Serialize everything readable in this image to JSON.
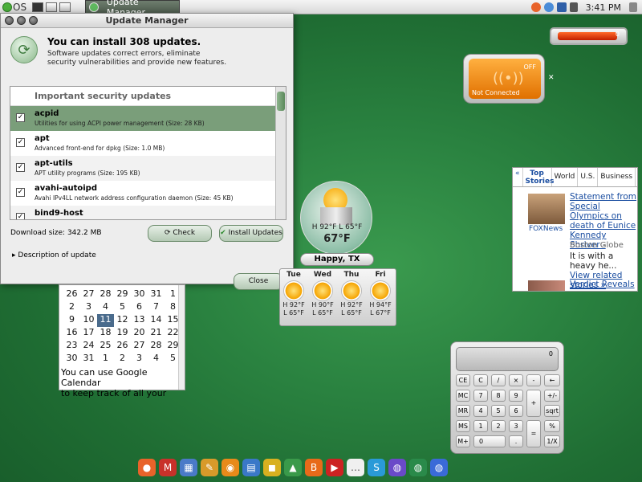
{
  "top_panel": {
    "os_label": "OS",
    "task_button": "Update Manager",
    "clock": "3:41 PM"
  },
  "update_window": {
    "title": "Update Manager",
    "heading": "You can install 308 updates.",
    "subtext_line1": "Software updates correct errors, eliminate",
    "subtext_line2": "security vulnerabilities and provide new features.",
    "list_header": "Important security updates",
    "items": [
      {
        "name": "acpid",
        "desc": "Utilities for using ACPI power management (Size: 28 KB)",
        "checked": "✓"
      },
      {
        "name": "apt",
        "desc": "Advanced front-end for dpkg (Size: 1.0 MB)",
        "checked": "✓"
      },
      {
        "name": "apt-utils",
        "desc": "APT utility programs (Size: 195 KB)",
        "checked": "✓"
      },
      {
        "name": "avahi-autoipd",
        "desc": "Avahi IPv4LL network address configuration daemon (Size: 45 KB)",
        "checked": "✓"
      },
      {
        "name": "bind9-host",
        "desc": "",
        "checked": "✓"
      }
    ],
    "download_size": "Download size: 342.2 MB",
    "check_button": "Check",
    "install_button": "Install Updates",
    "description_toggle": "Description of update",
    "close_button": "Close"
  },
  "calendar": {
    "rows": [
      [
        "26",
        "27",
        "28",
        "29",
        "30",
        "31",
        "1"
      ],
      [
        "2",
        "3",
        "4",
        "5",
        "6",
        "7",
        "8"
      ],
      [
        "9",
        "10",
        "11",
        "12",
        "13",
        "14",
        "15"
      ],
      [
        "16",
        "17",
        "18",
        "19",
        "20",
        "21",
        "22"
      ],
      [
        "23",
        "24",
        "25",
        "26",
        "27",
        "28",
        "29"
      ],
      [
        "30",
        "31",
        "1",
        "2",
        "3",
        "4",
        "5"
      ]
    ],
    "today": "11",
    "note_line1": "You can use Google Calendar",
    "note_line2": "to keep track of all your"
  },
  "battery": {
    "value": "0",
    "level": 0.85
  },
  "wireless": {
    "state": "OFF",
    "status": "Not Connected"
  },
  "weather": {
    "hi_lo": "H 92°F  L 65°F",
    "current": "67°F",
    "city": "Happy, TX",
    "forecast": [
      {
        "day": "Tue",
        "hi": "H 92°F",
        "lo": "L 65°F"
      },
      {
        "day": "Wed",
        "hi": "H 90°F",
        "lo": "L 65°F"
      },
      {
        "day": "Thu",
        "hi": "H 92°F",
        "lo": "L 65°F"
      },
      {
        "day": "Fri",
        "hi": "H 94°F",
        "lo": "L 67°F"
      }
    ]
  },
  "news": {
    "tabs": [
      "Top Stories",
      "World",
      "U.S.",
      "Business"
    ],
    "headline": "Statement from Special Olympics on death of Eunice Kennedy Shriver",
    "headline_dash": " -",
    "source_img_caption": "FOXNews",
    "source": "Boston Globe",
    "body": "It is with a heavy he...",
    "related_link": "View related stories »",
    "headline2": "Verdict Reveals"
  },
  "calculator": {
    "display": "0",
    "keys": {
      "ce": "CE",
      "c": "C",
      "div": "/",
      "mul": "×",
      "back": "←",
      "mc": "MC",
      "seven": "7",
      "eight": "8",
      "nine": "9",
      "plusminus": "+/-",
      "mr": "MR",
      "four": "4",
      "five": "5",
      "six": "6",
      "plus": "+",
      "sqrt": "sqrt",
      "ms": "MS",
      "one": "1",
      "two": "2",
      "three": "3",
      "percent": "%",
      "mplus": "M+",
      "zero": "0",
      "dot": ".",
      "equals": "=",
      "inv": "1/X",
      "minus": "-"
    }
  },
  "dock": {
    "icons": [
      "firefox-icon",
      "gmail-icon",
      "calendar-icon",
      "office-icon",
      "rss-icon",
      "docs-icon",
      "shopping-icon",
      "picasa-icon",
      "blogger-icon",
      "youtube-icon",
      "chat-icon",
      "skype-icon",
      "app1-icon",
      "app2-icon",
      "app3-icon"
    ]
  }
}
